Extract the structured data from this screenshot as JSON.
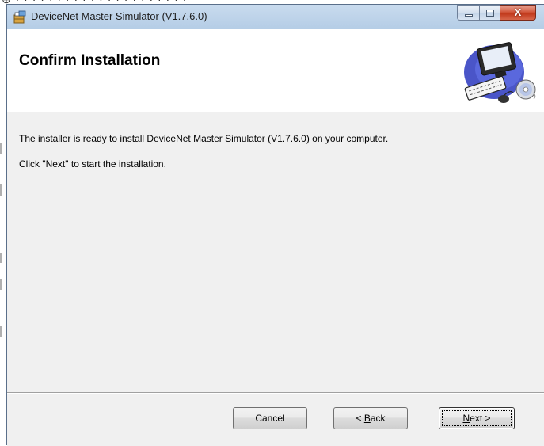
{
  "window": {
    "title": "DeviceNet Master Simulator (V1.7.6.0)",
    "caption_buttons": {
      "minimize": "–",
      "maximize": "□",
      "close": "X"
    }
  },
  "banner": {
    "title": "Confirm Installation",
    "art_icon": "computer-disc-icon"
  },
  "body": {
    "line1": "The installer is ready to install DeviceNet Master Simulator (V1.7.6.0) on your computer.",
    "line2": "Click \"Next\" to start the installation."
  },
  "buttons": {
    "cancel": "Cancel",
    "back_prefix": "< ",
    "back_accel": "B",
    "back_rest": "ack",
    "next_accel": "N",
    "next_rest": "ext >"
  },
  "colors": {
    "dialog_bg": "#f0f0f0",
    "banner_bg": "#ffffff",
    "close_button": "#c1381b",
    "frame": "#b5cde6"
  }
}
